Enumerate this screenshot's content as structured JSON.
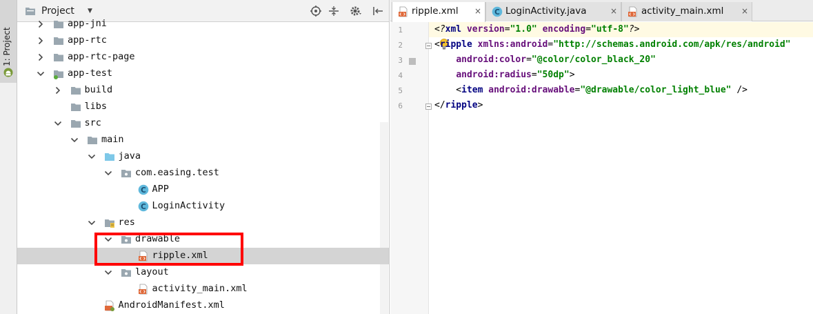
{
  "tool_window_strip": {
    "project_tab": "1: Project"
  },
  "project_panel": {
    "title": "Project",
    "toolbar": [
      "locate-icon",
      "collapse-all-icon",
      "settings-icon",
      "hide-icon"
    ],
    "tree": [
      {
        "label": "app-jni",
        "depth": 1,
        "expanded": false,
        "icon": "folder-icon"
      },
      {
        "label": "app-rtc",
        "depth": 1,
        "expanded": false,
        "icon": "folder-icon"
      },
      {
        "label": "app-rtc-page",
        "depth": 1,
        "expanded": false,
        "icon": "folder-icon"
      },
      {
        "label": "app-test",
        "depth": 1,
        "expanded": true,
        "icon": "module-folder-icon"
      },
      {
        "label": "build",
        "depth": 2,
        "expanded": false,
        "icon": "folder-icon"
      },
      {
        "label": "libs",
        "depth": 2,
        "expanded": null,
        "icon": "folder-icon"
      },
      {
        "label": "src",
        "depth": 2,
        "expanded": true,
        "icon": "folder-icon"
      },
      {
        "label": "main",
        "depth": 3,
        "expanded": true,
        "icon": "folder-icon"
      },
      {
        "label": "java",
        "depth": 4,
        "expanded": true,
        "icon": "source-folder-icon"
      },
      {
        "label": "com.easing.test",
        "depth": 5,
        "expanded": true,
        "icon": "package-icon"
      },
      {
        "label": "APP",
        "depth": 6,
        "expanded": null,
        "icon": "class-icon"
      },
      {
        "label": "LoginActivity",
        "depth": 6,
        "expanded": null,
        "icon": "class-icon"
      },
      {
        "label": "res",
        "depth": 4,
        "expanded": true,
        "icon": "resource-folder-icon"
      },
      {
        "label": "drawable",
        "depth": 5,
        "expanded": true,
        "icon": "package-icon"
      },
      {
        "label": "ripple.xml",
        "depth": 6,
        "expanded": null,
        "icon": "xml-file-icon",
        "selected": true
      },
      {
        "label": "layout",
        "depth": 5,
        "expanded": true,
        "icon": "package-icon"
      },
      {
        "label": "activity_main.xml",
        "depth": 6,
        "expanded": null,
        "icon": "xml-file-icon"
      },
      {
        "label": "AndroidManifest.xml",
        "depth": 4,
        "expanded": null,
        "icon": "manifest-file-icon"
      }
    ]
  },
  "editor": {
    "tabs": [
      {
        "label": "ripple.xml",
        "icon": "xml-file-icon",
        "active": true
      },
      {
        "label": "LoginActivity.java",
        "icon": "class-icon",
        "active": false
      },
      {
        "label": "activity_main.xml",
        "icon": "xml-file-icon",
        "active": false
      }
    ],
    "line_numbers": [
      "1",
      "2",
      "3",
      "4",
      "5",
      "6"
    ],
    "code_lines": [
      [
        {
          "t": "<?",
          "c": "pi"
        },
        {
          "t": "xml ",
          "c": "kw"
        },
        {
          "t": "version",
          "c": "attr"
        },
        {
          "t": "=",
          "c": "plain"
        },
        {
          "t": "\"1.0\"",
          "c": "str"
        },
        {
          "t": " ",
          "c": "plain"
        },
        {
          "t": "encoding",
          "c": "attr"
        },
        {
          "t": "=",
          "c": "plain"
        },
        {
          "t": "\"utf-8\"",
          "c": "str"
        },
        {
          "t": "?>",
          "c": "pi"
        }
      ],
      [
        {
          "t": "<",
          "c": "plain"
        },
        {
          "t": "ripple ",
          "c": "kw"
        },
        {
          "t": "xmlns:android",
          "c": "attr"
        },
        {
          "t": "=",
          "c": "plain"
        },
        {
          "t": "\"http://schemas.android.com/apk/res/android\"",
          "c": "str"
        }
      ],
      [
        {
          "t": "    ",
          "c": "plain"
        },
        {
          "t": "android:color",
          "c": "attr"
        },
        {
          "t": "=",
          "c": "plain"
        },
        {
          "t": "\"@color/color_black_20\"",
          "c": "str"
        }
      ],
      [
        {
          "t": "    ",
          "c": "plain"
        },
        {
          "t": "android:radius",
          "c": "attr"
        },
        {
          "t": "=",
          "c": "plain"
        },
        {
          "t": "\"50dp\"",
          "c": "str"
        },
        {
          "t": ">",
          "c": "plain"
        }
      ],
      [
        {
          "t": "    <",
          "c": "plain"
        },
        {
          "t": "item ",
          "c": "kw"
        },
        {
          "t": "android:drawable",
          "c": "attr"
        },
        {
          "t": "=",
          "c": "plain"
        },
        {
          "t": "\"@drawable/color_light_blue\"",
          "c": "str"
        },
        {
          "t": " />",
          "c": "plain"
        }
      ],
      [
        {
          "t": "</",
          "c": "plain"
        },
        {
          "t": "ripple",
          "c": "kw"
        },
        {
          "t": ">",
          "c": "plain"
        }
      ]
    ]
  },
  "colors": {
    "selection_row": "#d4d4d4",
    "highlight_box": "#ff0000",
    "folder": "#9aa7b0",
    "source_folder": "#7ec8e8",
    "class_icon": "#5fb8dc",
    "xml_icon": "#e06a3b"
  }
}
